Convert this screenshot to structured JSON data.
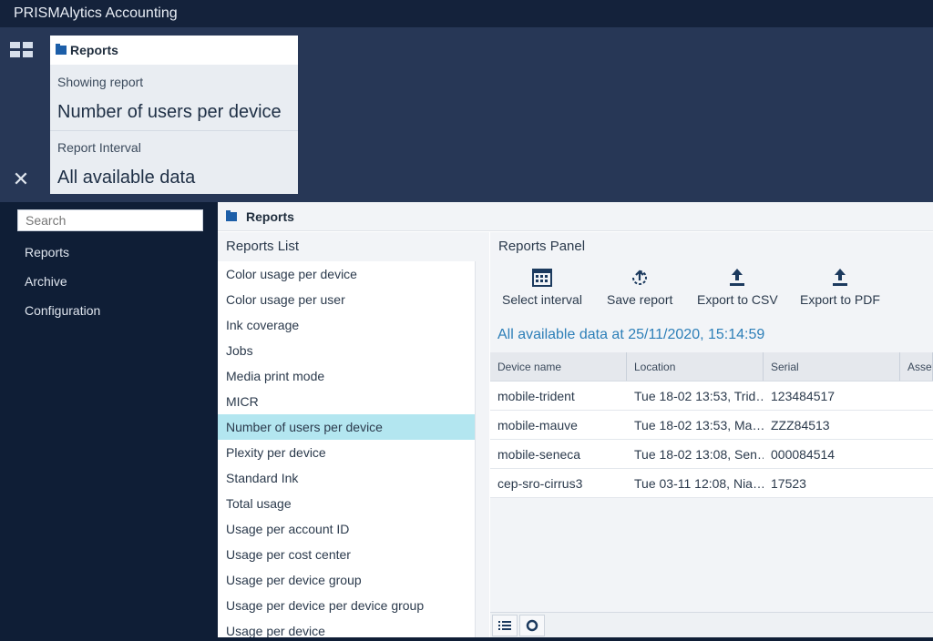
{
  "app": {
    "title": "PRISMAlytics Accounting"
  },
  "header_card": {
    "title": "Reports",
    "showing_label": "Showing report",
    "showing_value": "Number of users per device",
    "interval_label": "Report Interval",
    "interval_value": "All available data"
  },
  "sidebar": {
    "search_placeholder": "Search",
    "items": [
      {
        "label": "Reports"
      },
      {
        "label": "Archive"
      },
      {
        "label": "Configuration"
      }
    ]
  },
  "main": {
    "title": "Reports"
  },
  "reports_list": {
    "title": "Reports List",
    "items": [
      "Color usage per device",
      "Color usage per user",
      "Ink coverage",
      "Jobs",
      "Media print mode",
      "MICR",
      "Number of users per device",
      "Plexity per device",
      "Standard Ink",
      "Total usage",
      "Usage per account ID",
      "Usage per cost center",
      "Usage per device group",
      "Usage per device per device group",
      "Usage per device"
    ],
    "selected": "Number of users per device"
  },
  "reports_panel": {
    "title": "Reports Panel",
    "toolbar": {
      "select_interval": "Select interval",
      "save_report": "Save report",
      "export_csv": "Export to CSV",
      "export_pdf": "Export to PDF"
    },
    "data_stamp": "All available data at 25/11/2020, 15:14:59",
    "table": {
      "headers": [
        "Device name",
        "Location",
        "Serial",
        "Asset"
      ],
      "rows": [
        [
          "mobile-trident",
          "Tue 18-02 13:53, Trid…",
          "123484517",
          ""
        ],
        [
          "mobile-mauve",
          "Tue 18-02 13:53, Ma…",
          "ZZZ84513",
          ""
        ],
        [
          "mobile-seneca",
          "Tue 18-02 13:08, Sen…",
          "000084514",
          ""
        ],
        [
          "cep-sro-cirrus3",
          "Tue 03-11 12:08, Nia…",
          "17523",
          ""
        ]
      ]
    }
  },
  "colors": {
    "accent": "#2d7fb8",
    "selected_row": "#b3e6f0",
    "header_bg": "#273756",
    "sidebar_bg": "#0f1e36"
  }
}
